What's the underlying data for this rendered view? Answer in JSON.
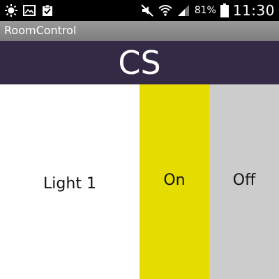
{
  "status_bar": {
    "battery_percent": "81%",
    "time": "11:30",
    "icons": [
      "brightness-icon",
      "image-icon",
      "clipboard-check-icon",
      "mute-icon",
      "wifi-icon",
      "signal-icon",
      "battery-icon"
    ]
  },
  "action_bar": {
    "title": "RoomControl"
  },
  "header": {
    "title": "CS"
  },
  "controls": [
    {
      "label": "Light 1",
      "on_label": "On",
      "off_label": "Off"
    }
  ],
  "colors": {
    "header_bg": "#352a45",
    "on_active": "#e6dd00",
    "off_inactive": "#cccccc",
    "status_bar_bg": "#000000"
  }
}
